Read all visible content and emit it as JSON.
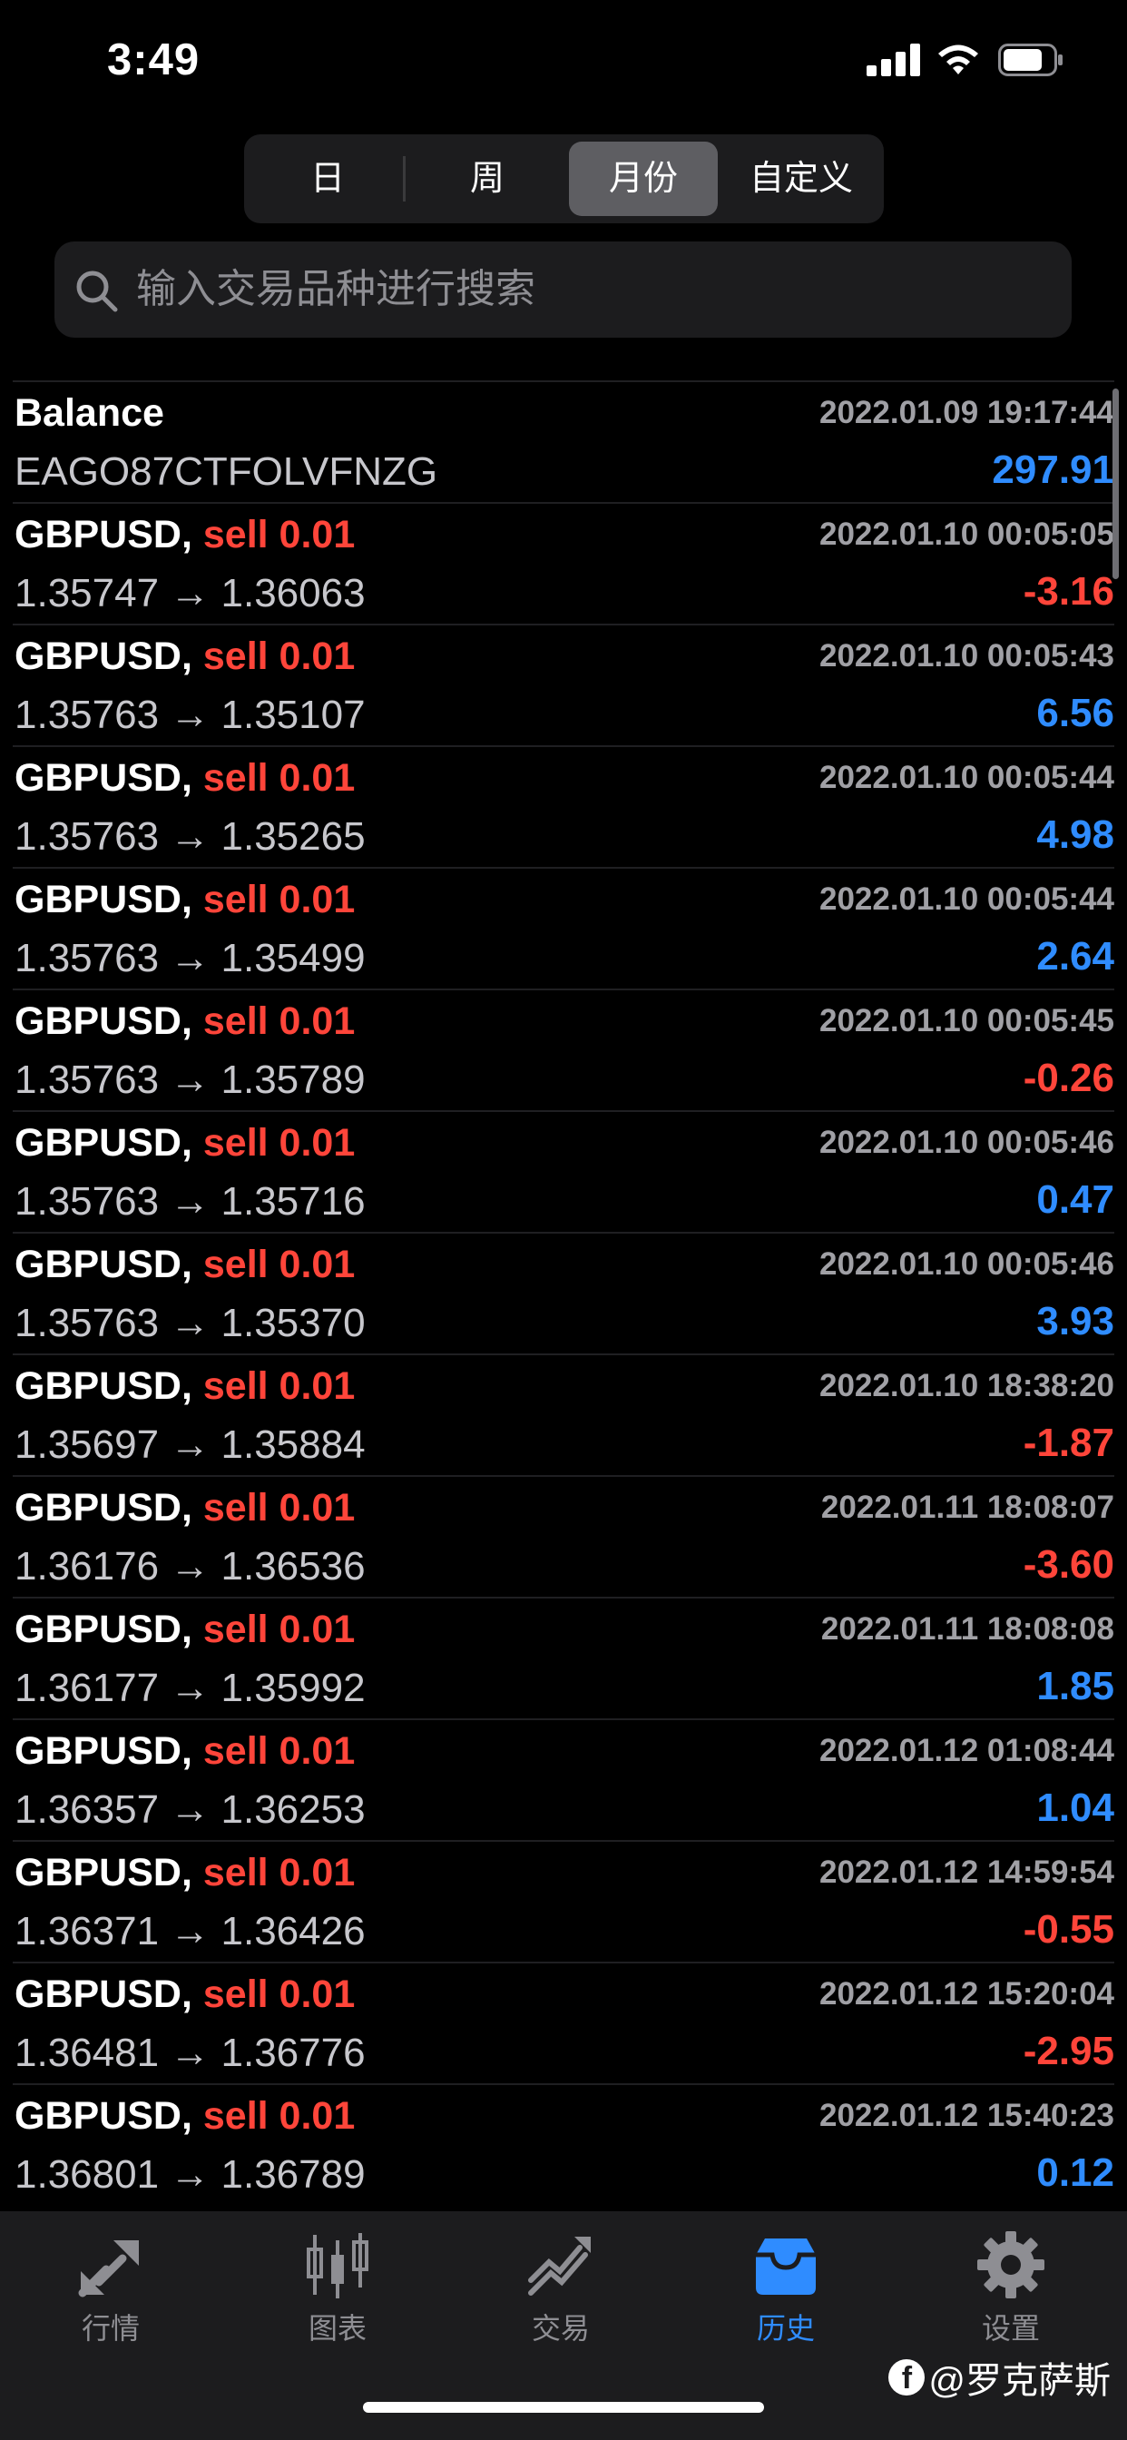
{
  "status_bar": {
    "time": "3:49"
  },
  "segments": [
    {
      "label": "日",
      "active": false
    },
    {
      "label": "周",
      "active": false
    },
    {
      "label": "月份",
      "active": true
    },
    {
      "label": "自定义",
      "active": false
    }
  ],
  "search": {
    "placeholder": "输入交易品种进行搜索"
  },
  "rows": [
    {
      "symbol": "Balance",
      "action": "",
      "date": "2022.01.09 19:17:44",
      "prices": "EAGO87CTFOLVFNZG",
      "profit": "297.91",
      "sign": "pos"
    },
    {
      "symbol": "GBPUSD,",
      "action": "sell 0.01",
      "date": "2022.01.10 00:05:05",
      "prices": "1.35747 → 1.36063",
      "profit": "-3.16",
      "sign": "neg"
    },
    {
      "symbol": "GBPUSD,",
      "action": "sell 0.01",
      "date": "2022.01.10 00:05:43",
      "prices": "1.35763 → 1.35107",
      "profit": "6.56",
      "sign": "pos"
    },
    {
      "symbol": "GBPUSD,",
      "action": "sell 0.01",
      "date": "2022.01.10 00:05:44",
      "prices": "1.35763 → 1.35265",
      "profit": "4.98",
      "sign": "pos"
    },
    {
      "symbol": "GBPUSD,",
      "action": "sell 0.01",
      "date": "2022.01.10 00:05:44",
      "prices": "1.35763 → 1.35499",
      "profit": "2.64",
      "sign": "pos"
    },
    {
      "symbol": "GBPUSD,",
      "action": "sell 0.01",
      "date": "2022.01.10 00:05:45",
      "prices": "1.35763 → 1.35789",
      "profit": "-0.26",
      "sign": "neg"
    },
    {
      "symbol": "GBPUSD,",
      "action": "sell 0.01",
      "date": "2022.01.10 00:05:46",
      "prices": "1.35763 → 1.35716",
      "profit": "0.47",
      "sign": "pos"
    },
    {
      "symbol": "GBPUSD,",
      "action": "sell 0.01",
      "date": "2022.01.10 00:05:46",
      "prices": "1.35763 → 1.35370",
      "profit": "3.93",
      "sign": "pos"
    },
    {
      "symbol": "GBPUSD,",
      "action": "sell 0.01",
      "date": "2022.01.10 18:38:20",
      "prices": "1.35697 → 1.35884",
      "profit": "-1.87",
      "sign": "neg"
    },
    {
      "symbol": "GBPUSD,",
      "action": "sell 0.01",
      "date": "2022.01.11 18:08:07",
      "prices": "1.36176 → 1.36536",
      "profit": "-3.60",
      "sign": "neg"
    },
    {
      "symbol": "GBPUSD,",
      "action": "sell 0.01",
      "date": "2022.01.11 18:08:08",
      "prices": "1.36177 → 1.35992",
      "profit": "1.85",
      "sign": "pos"
    },
    {
      "symbol": "GBPUSD,",
      "action": "sell 0.01",
      "date": "2022.01.12 01:08:44",
      "prices": "1.36357 → 1.36253",
      "profit": "1.04",
      "sign": "pos"
    },
    {
      "symbol": "GBPUSD,",
      "action": "sell 0.01",
      "date": "2022.01.12 14:59:54",
      "prices": "1.36371 → 1.36426",
      "profit": "-0.55",
      "sign": "neg"
    },
    {
      "symbol": "GBPUSD,",
      "action": "sell 0.01",
      "date": "2022.01.12 15:20:04",
      "prices": "1.36481 → 1.36776",
      "profit": "-2.95",
      "sign": "neg"
    },
    {
      "symbol": "GBPUSD,",
      "action": "sell 0.01",
      "date": "2022.01.12 15:40:23",
      "prices": "1.36801 → 1.36789",
      "profit": "0.12",
      "sign": "pos"
    }
  ],
  "tabbar": [
    {
      "label": "行情",
      "icon": "quotes-icon",
      "active": false
    },
    {
      "label": "图表",
      "icon": "chart-icon",
      "active": false
    },
    {
      "label": "交易",
      "icon": "trade-icon",
      "active": false
    },
    {
      "label": "历史",
      "icon": "history-icon",
      "active": true
    },
    {
      "label": "设置",
      "icon": "settings-icon",
      "active": false
    }
  ],
  "watermark": {
    "text": "@罗克萨斯"
  },
  "colors": {
    "background": "#000000",
    "positive": "#2f8cff",
    "negative": "#ff453a",
    "active_tab": "#2f8cff"
  }
}
